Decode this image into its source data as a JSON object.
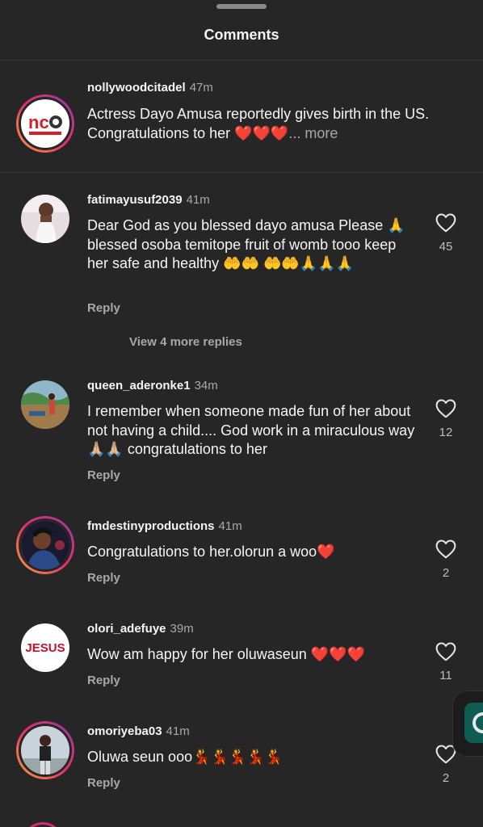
{
  "header": {
    "title": "Comments"
  },
  "caption": {
    "username": "nollywoodcitadel",
    "time": "47m",
    "text": "Actress Dayo Amusa reportedly gives birth in the US. Congratulations to her ❤️❤️❤️",
    "more": "... more"
  },
  "comments": [
    {
      "username": "fatimayusuf2039",
      "time": "41m",
      "text": "Dear God as you blessed dayo amusa Please 🙏blessed osoba temitope fruit of womb tooo keep her safe and healthy 🤲🤲 🤲🤲🙏🙏🙏",
      "reply": "Reply",
      "likes": "45",
      "view_replies": "View 4 more replies"
    },
    {
      "username": "queen_aderonke1",
      "time": "34m",
      "text": "I remember when someone made fun of her about not having a child.... God work in a miraculous way🙏🏼🙏🏼 congratulations to her",
      "reply": "Reply",
      "likes": "12"
    },
    {
      "username": "fmdestinyproductions",
      "time": "41m",
      "text": "Congratulations to her.olorun a woo❤️",
      "reply": "Reply",
      "likes": "2"
    },
    {
      "username": "olori_adefuye",
      "time": "39m",
      "text": "Wow am happy for her oluwaseun ❤️❤️❤️",
      "reply": "Reply",
      "likes": "11",
      "avatar_text": "JESUS"
    },
    {
      "username": "omoriyeba03",
      "time": "41m",
      "text": "Oluwa seun ooo💃💃💃💃💃",
      "reply": "Reply",
      "likes": "2"
    }
  ],
  "icons": {
    "like": "heart-outline-icon",
    "floating": "whatsapp-icon"
  },
  "colors": {
    "background": "#262626",
    "text": "#f5f5f5",
    "secondary": "#a8a8a8",
    "story_ring": "#e3306c",
    "logo_red": "#d81e2a"
  }
}
